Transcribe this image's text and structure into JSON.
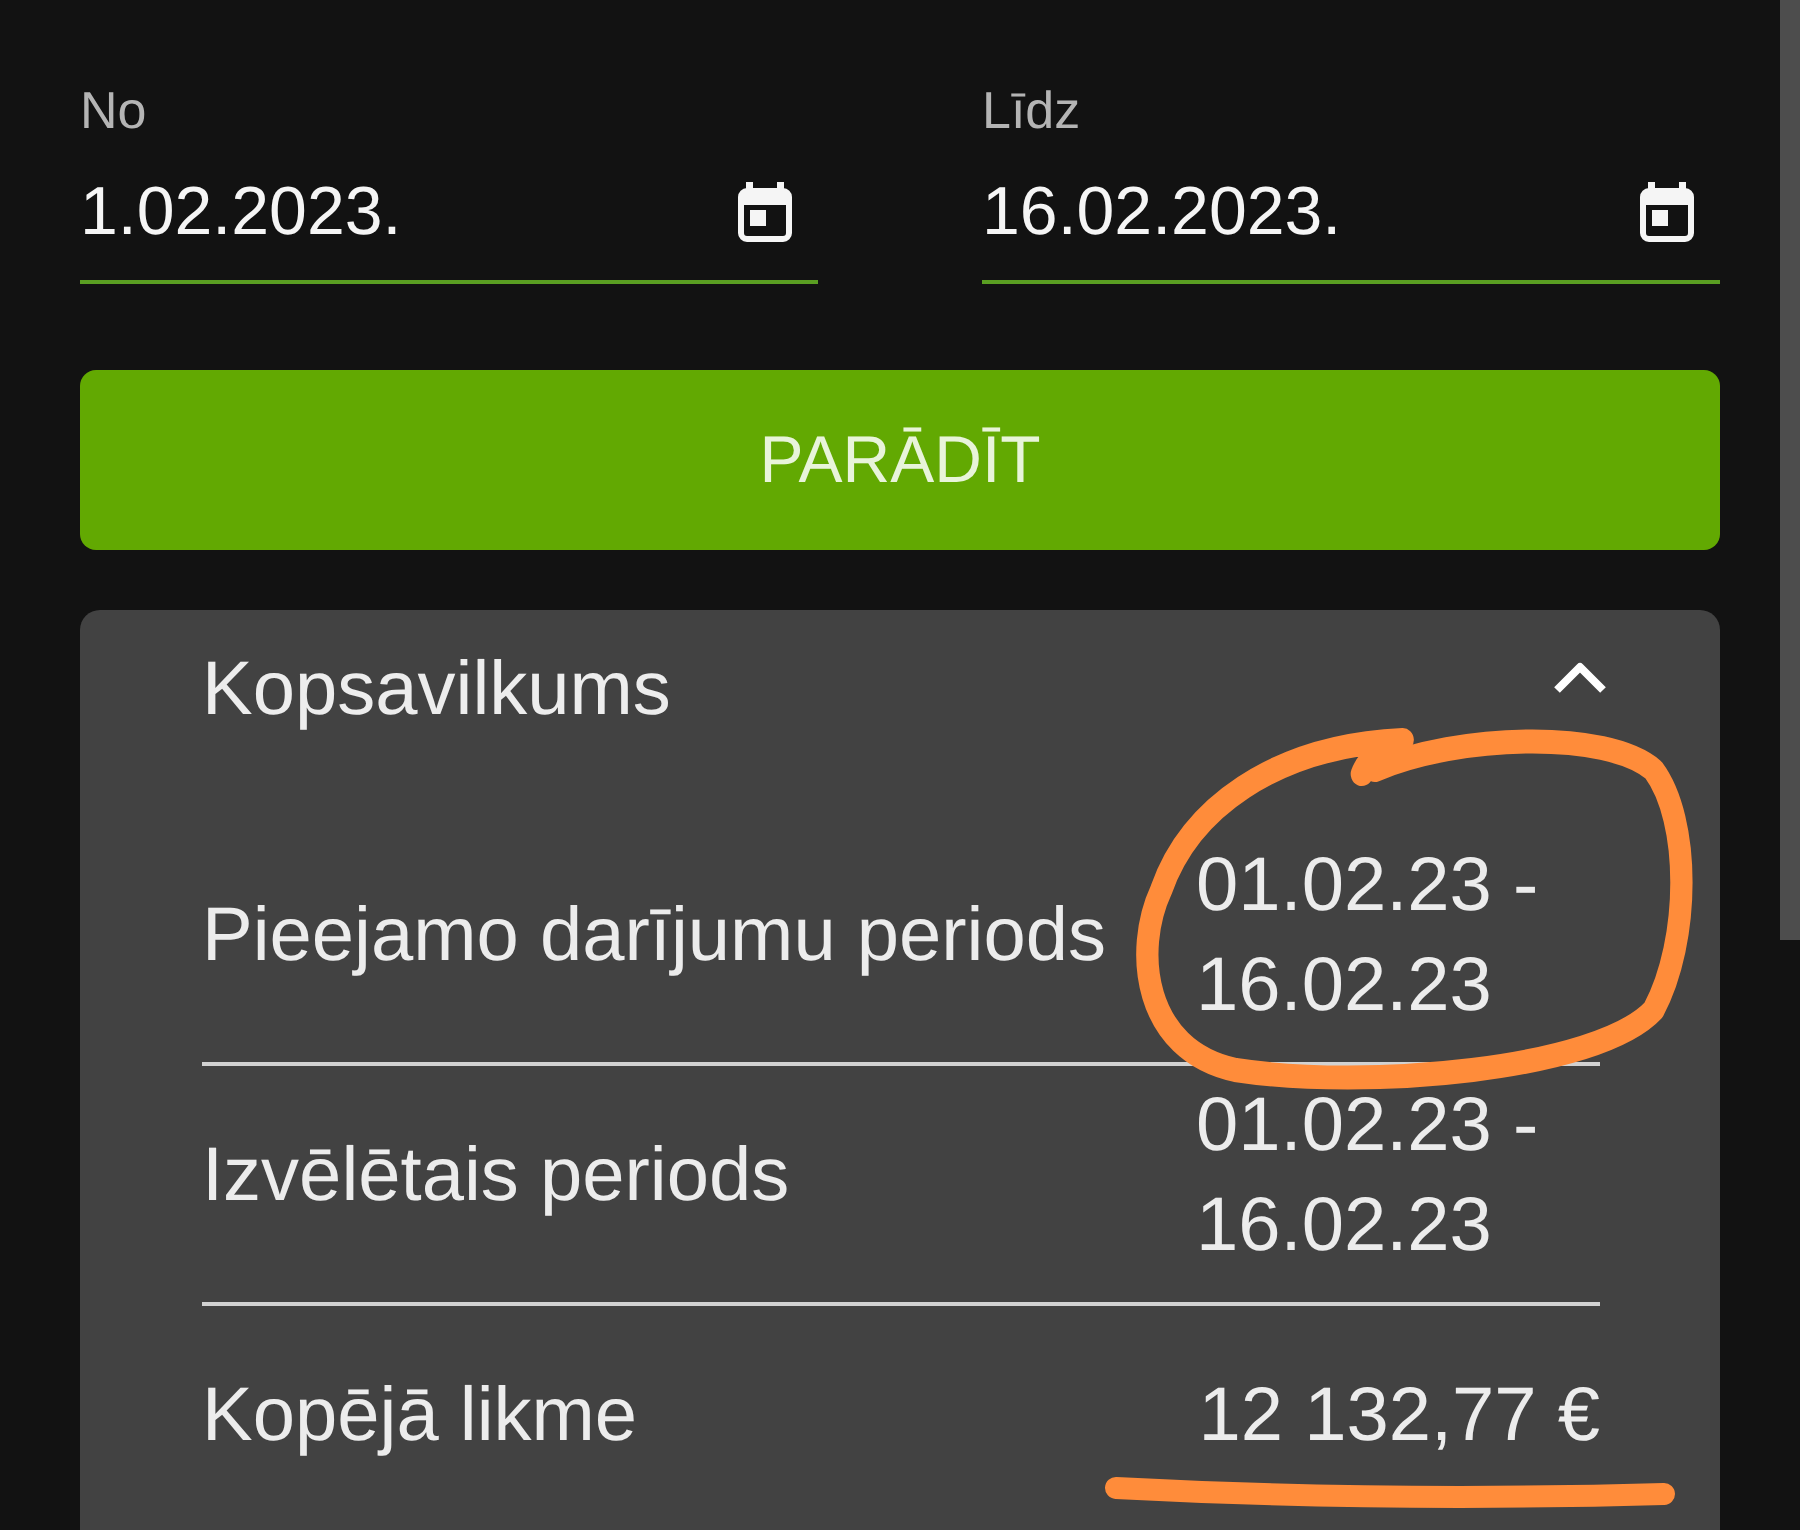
{
  "date_fields": [
    {
      "label": "No",
      "value": "1.02.2023."
    },
    {
      "label": "Līdz",
      "value": "16.02.2023."
    }
  ],
  "show_button": {
    "label": "PARĀDĪT"
  },
  "summary": {
    "title": "Kopsavilkums",
    "expanded": true,
    "rows": [
      {
        "label": "Pieejamo darījumu periods",
        "value": "01.02.23 - 16.02.23"
      },
      {
        "label": "Izvēlētais periods",
        "value": "01.02.23 - 16.02.23"
      },
      {
        "label": "Kopējā likme",
        "value": "12 132,77 €"
      }
    ]
  }
}
